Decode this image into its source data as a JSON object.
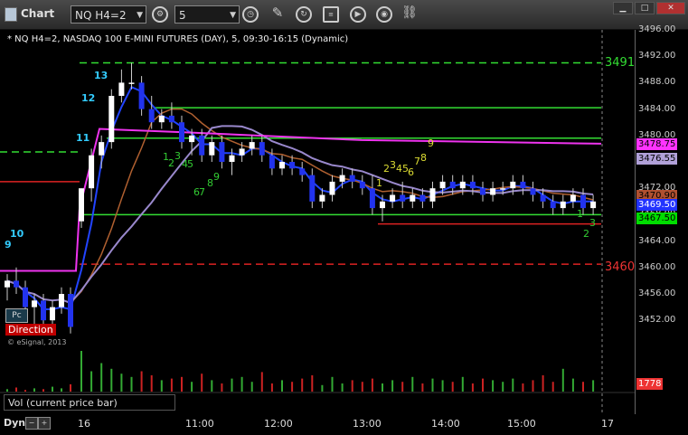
{
  "window": {
    "title": "Chart"
  },
  "toolbar": {
    "symbol": "NQ H4=2",
    "interval": "5",
    "buttons": [
      "settings-icon",
      "clock-icon",
      "pencil-icon",
      "refresh-icon",
      "indicator-icon",
      "play-icon",
      "broadcast-icon",
      "link-icon"
    ]
  },
  "chart": {
    "study_line": "* NQ H4=2, NASDAQ 100 E-MINI FUTURES (DAY), 5, 09:30-16:15 (Dynamic)",
    "copyright": "© eSignal, 2013",
    "pc_label": "Pc",
    "direction_label": "Direction",
    "level_labels": [
      {
        "text": "3491",
        "color": "#33dd33"
      },
      {
        "text": "3460",
        "color": "#ee3333"
      }
    ],
    "price_ticks": [
      "3496.00",
      "3492.00",
      "3488.00",
      "3484.00",
      "3480.00",
      "3476.00",
      "3472.00",
      "3468.00",
      "3464.00",
      "3460.00",
      "3456.00",
      "3452.00"
    ],
    "price_tags": [
      {
        "text": "3478.75",
        "bg": "#ff33ff"
      },
      {
        "text": "3476.55",
        "bg": "#b0a0d8"
      },
      {
        "text": "3470.90",
        "bg": "#b05030"
      },
      {
        "text": "3469.50",
        "bg": "#2233ff"
      },
      {
        "text": "3467.50",
        "bg": "#00dd00"
      }
    ],
    "seq_labels": [
      {
        "text": "13",
        "color": "#33ccff"
      },
      {
        "text": "12",
        "color": "#33ccff"
      },
      {
        "text": "11",
        "color": "#33ccff"
      },
      {
        "text": "10",
        "color": "#33ccff"
      },
      {
        "text": "9",
        "color": "#33ccff"
      },
      {
        "text": "1",
        "color": "#33cc33"
      },
      {
        "text": "2",
        "color": "#33cc33"
      },
      {
        "text": "3",
        "color": "#33cc33"
      },
      {
        "text": "4",
        "color": "#33cc33"
      },
      {
        "text": "5",
        "color": "#33cc33"
      },
      {
        "text": "6",
        "color": "#33cc33"
      },
      {
        "text": "7",
        "color": "#33cc33"
      },
      {
        "text": "8",
        "color": "#33cc33"
      },
      {
        "text": "9",
        "color": "#33cc33"
      },
      {
        "text": "1",
        "color": "#dddd33"
      },
      {
        "text": "2",
        "color": "#dddd33"
      },
      {
        "text": "3",
        "color": "#dddd33"
      },
      {
        "text": "4",
        "color": "#dddd33"
      },
      {
        "text": "5",
        "color": "#dddd33"
      },
      {
        "text": "6",
        "color": "#dddd33"
      },
      {
        "text": "7",
        "color": "#dddd33"
      },
      {
        "text": "8",
        "color": "#dddd33"
      },
      {
        "text": "9",
        "color": "#dddd33"
      },
      {
        "text": "1",
        "color": "#33cc33"
      },
      {
        "text": "2",
        "color": "#33cc33"
      },
      {
        "text": "3",
        "color": "#33cc33"
      }
    ]
  },
  "volume": {
    "label": "Vol (current price bar)",
    "value": "1778",
    "value_bg": "#ee3333"
  },
  "time_axis": {
    "dyn_label": "Dyn",
    "labels": [
      "16",
      "11:00",
      "12:00",
      "13:00",
      "14:00",
      "15:00",
      "17"
    ]
  },
  "chart_data": {
    "type": "candlestick",
    "title": "NQ H4=2, NASDAQ 100 E-MINI FUTURES (DAY), 5, 09:30-16:15 (Dynamic)",
    "ylim": [
      3448,
      3497
    ],
    "grid": false,
    "candles": [
      {
        "open": 3457,
        "high": 3459,
        "low": 3455,
        "close": 3458
      },
      {
        "open": 3458,
        "high": 3460,
        "low": 3456,
        "close": 3457
      },
      {
        "open": 3457,
        "high": 3458,
        "low": 3453,
        "close": 3454
      },
      {
        "open": 3454,
        "high": 3456,
        "low": 3451,
        "close": 3455
      },
      {
        "open": 3455,
        "high": 3456,
        "low": 3451,
        "close": 3452
      },
      {
        "open": 3452,
        "high": 3455,
        "low": 3451,
        "close": 3454
      },
      {
        "open": 3454,
        "high": 3457,
        "low": 3453,
        "close": 3456
      },
      {
        "open": 3456,
        "high": 3457,
        "low": 3450,
        "close": 3451
      },
      {
        "open": 3467,
        "high": 3472,
        "low": 3466,
        "close": 3472
      },
      {
        "open": 3472,
        "high": 3478,
        "low": 3470,
        "close": 3477
      },
      {
        "open": 3477,
        "high": 3480,
        "low": 3475,
        "close": 3479
      },
      {
        "open": 3479,
        "high": 3487,
        "low": 3478,
        "close": 3486
      },
      {
        "open": 3486,
        "high": 3490,
        "low": 3485,
        "close": 3488
      },
      {
        "open": 3488,
        "high": 3491,
        "low": 3487,
        "close": 3488
      },
      {
        "open": 3488,
        "high": 3489,
        "low": 3483,
        "close": 3484
      },
      {
        "open": 3484,
        "high": 3486,
        "low": 3481,
        "close": 3482
      },
      {
        "open": 3482,
        "high": 3484,
        "low": 3481,
        "close": 3483
      },
      {
        "open": 3483,
        "high": 3485,
        "low": 3481,
        "close": 3482
      },
      {
        "open": 3482,
        "high": 3483,
        "low": 3478,
        "close": 3479
      },
      {
        "open": 3479,
        "high": 3481,
        "low": 3477,
        "close": 3480
      },
      {
        "open": 3480,
        "high": 3481,
        "low": 3476,
        "close": 3477
      },
      {
        "open": 3477,
        "high": 3480,
        "low": 3476,
        "close": 3479
      },
      {
        "open": 3479,
        "high": 3480,
        "low": 3475,
        "close": 3476
      },
      {
        "open": 3476,
        "high": 3478,
        "low": 3474,
        "close": 3477
      },
      {
        "open": 3477,
        "high": 3479,
        "low": 3476,
        "close": 3478
      },
      {
        "open": 3478,
        "high": 3480,
        "low": 3477,
        "close": 3479
      },
      {
        "open": 3479,
        "high": 3480,
        "low": 3476,
        "close": 3477
      },
      {
        "open": 3477,
        "high": 3478,
        "low": 3474,
        "close": 3475
      },
      {
        "open": 3475,
        "high": 3477,
        "low": 3474,
        "close": 3476
      },
      {
        "open": 3476,
        "high": 3477,
        "low": 3474,
        "close": 3475
      },
      {
        "open": 3475,
        "high": 3476,
        "low": 3473,
        "close": 3474
      },
      {
        "open": 3474,
        "high": 3475,
        "low": 3469,
        "close": 3470
      },
      {
        "open": 3470,
        "high": 3472,
        "low": 3469,
        "close": 3471
      },
      {
        "open": 3471,
        "high": 3474,
        "low": 3470,
        "close": 3473
      },
      {
        "open": 3473,
        "high": 3475,
        "low": 3472,
        "close": 3474
      },
      {
        "open": 3474,
        "high": 3475,
        "low": 3472,
        "close": 3473
      },
      {
        "open": 3473,
        "high": 3474,
        "low": 3471,
        "close": 3472
      },
      {
        "open": 3472,
        "high": 3474,
        "low": 3468,
        "close": 3469
      },
      {
        "open": 3469,
        "high": 3471,
        "low": 3467,
        "close": 3470
      },
      {
        "open": 3470,
        "high": 3472,
        "low": 3469,
        "close": 3471
      },
      {
        "open": 3471,
        "high": 3473,
        "low": 3469,
        "close": 3470
      },
      {
        "open": 3470,
        "high": 3472,
        "low": 3469,
        "close": 3471
      },
      {
        "open": 3471,
        "high": 3472,
        "low": 3469,
        "close": 3470
      },
      {
        "open": 3470,
        "high": 3473,
        "low": 3469,
        "close": 3472
      },
      {
        "open": 3472,
        "high": 3474,
        "low": 3471,
        "close": 3473
      },
      {
        "open": 3473,
        "high": 3474,
        "low": 3471,
        "close": 3472
      },
      {
        "open": 3472,
        "high": 3474,
        "low": 3471,
        "close": 3473
      },
      {
        "open": 3473,
        "high": 3474,
        "low": 3471,
        "close": 3472
      },
      {
        "open": 3472,
        "high": 3473,
        "low": 3470,
        "close": 3471
      },
      {
        "open": 3471,
        "high": 3473,
        "low": 3470,
        "close": 3472
      },
      {
        "open": 3472,
        "high": 3473,
        "low": 3471,
        "close": 3472
      },
      {
        "open": 3472,
        "high": 3474,
        "low": 3471,
        "close": 3473
      },
      {
        "open": 3473,
        "high": 3474,
        "low": 3471,
        "close": 3472
      },
      {
        "open": 3472,
        "high": 3473,
        "low": 3470,
        "close": 3471
      },
      {
        "open": 3471,
        "high": 3472,
        "low": 3469,
        "close": 3470
      },
      {
        "open": 3470,
        "high": 3471,
        "low": 3468,
        "close": 3469
      },
      {
        "open": 3469,
        "high": 3471,
        "low": 3468,
        "close": 3470
      },
      {
        "open": 3470,
        "high": 3472,
        "low": 3469,
        "close": 3471
      },
      {
        "open": 3471,
        "high": 3472,
        "low": 3468,
        "close": 3469
      },
      {
        "open": 3469,
        "high": 3471,
        "low": 3468,
        "close": 3470
      }
    ],
    "volumes": [
      3,
      5,
      2,
      4,
      3,
      6,
      4,
      9,
      50,
      25,
      35,
      28,
      22,
      18,
      25,
      20,
      14,
      16,
      18,
      12,
      22,
      14,
      10,
      16,
      18,
      12,
      24,
      10,
      14,
      12,
      16,
      20,
      8,
      18,
      10,
      14,
      12,
      16,
      10,
      14,
      12,
      18,
      10,
      16,
      14,
      12,
      18,
      10,
      16,
      14,
      12,
      16,
      10,
      14,
      20,
      12,
      28,
      16,
      12,
      14
    ]
  }
}
